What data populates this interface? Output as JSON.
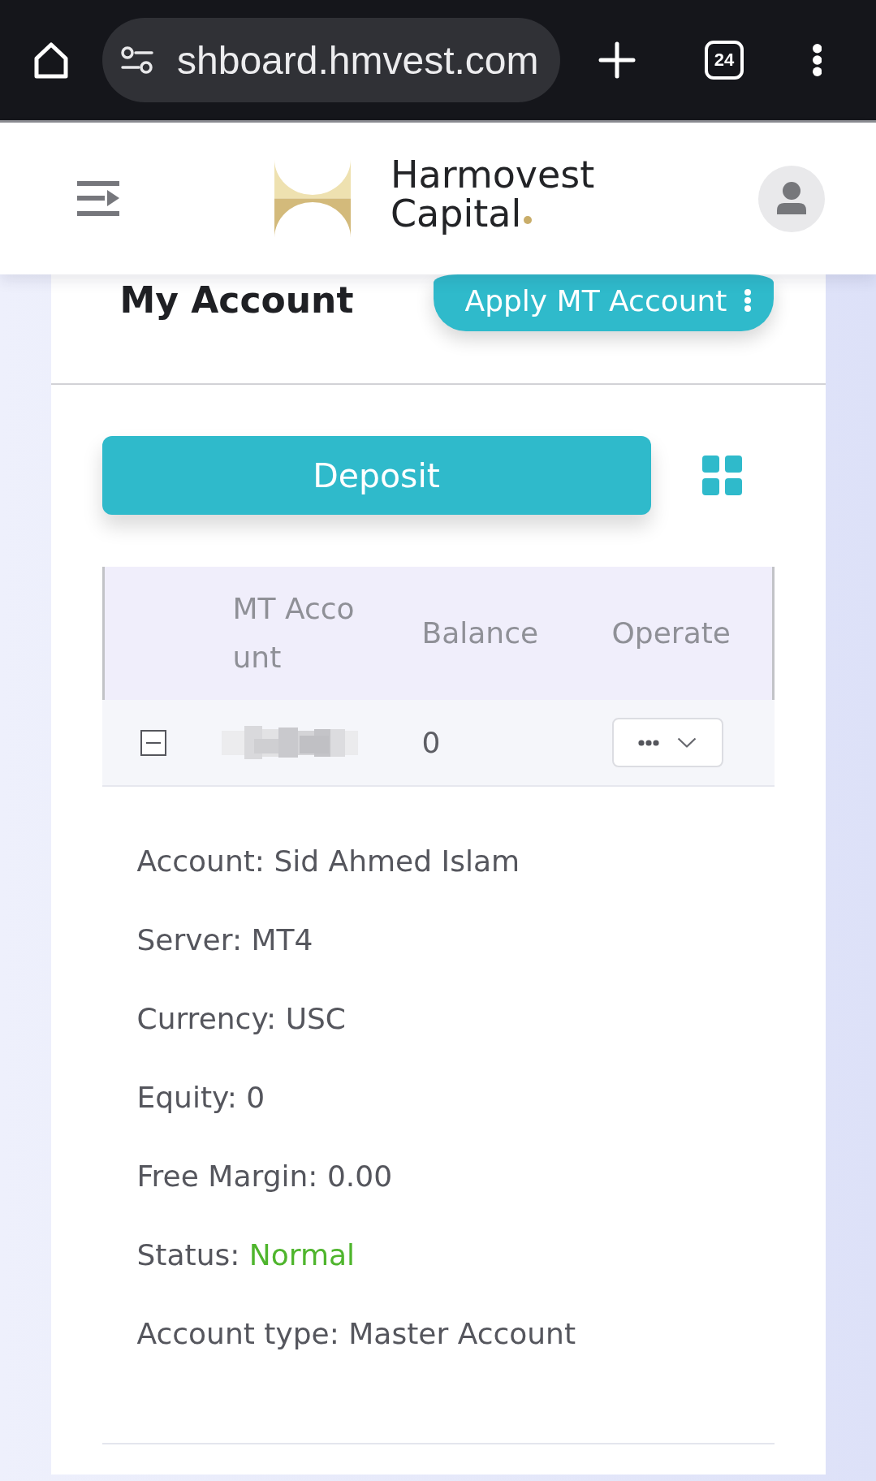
{
  "browser": {
    "url": "shboard.hmvest.com",
    "tab_count": "24"
  },
  "brand": {
    "lines": [
      "Harmovest",
      "Capital"
    ]
  },
  "page": {
    "title": "My Account",
    "apply_button": "Apply MT Account",
    "deposit_button": "Deposit"
  },
  "table": {
    "columns": [
      "MT Account",
      "Balance",
      "Operate"
    ],
    "rows": [
      {
        "expanded": true,
        "balance": "0",
        "details": [
          {
            "kind": "text",
            "label": "Account:",
            "value": "Sid Ahmed Islam"
          },
          {
            "kind": "text",
            "label": "Server:",
            "value": "MT4"
          },
          {
            "kind": "text",
            "label": "Currency:",
            "value": "USC"
          },
          {
            "kind": "text",
            "label": "Equity:",
            "value": "0"
          },
          {
            "kind": "text",
            "label": "Free Margin:",
            "value": "0.00"
          },
          {
            "kind": "status",
            "label": "Status:",
            "value": "Normal"
          },
          {
            "kind": "text",
            "label": "Account type:",
            "value": "Master Account"
          }
        ]
      }
    ]
  }
}
